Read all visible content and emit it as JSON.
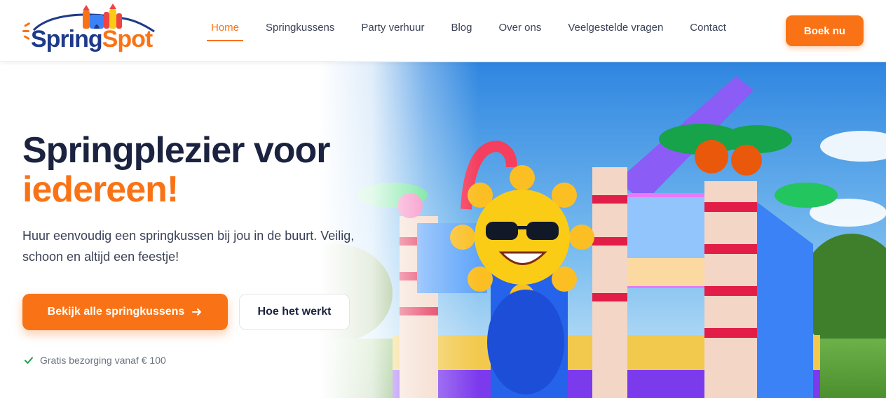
{
  "brand": {
    "name_part1": "Spring",
    "name_part2": "Spot"
  },
  "nav": {
    "items": [
      {
        "label": "Home",
        "active": true
      },
      {
        "label": "Springkussens"
      },
      {
        "label": "Party verhuur"
      },
      {
        "label": "Blog"
      },
      {
        "label": "Over ons"
      },
      {
        "label": "Veelgestelde vragen"
      },
      {
        "label": "Contact"
      }
    ],
    "cta_label": "Boek nu"
  },
  "hero": {
    "title_line1": "Springplezier voor",
    "title_line2": "iedereen!",
    "subtitle": "Huur eenvoudig een springkussen bij jou in de buurt. Veilig, schoon en altijd een feestje!",
    "primary_button": "Bekijk alle springkussens",
    "secondary_button": "Hoe het werkt",
    "perk": "Gratis bezorging vanaf € 100"
  },
  "colors": {
    "accent": "#f97316",
    "navy": "#1b2340",
    "brand_blue": "#1e3a8a",
    "check": "#16a34a"
  },
  "icons": {
    "primary_button_icon": "arrow-right-icon",
    "perk_icon": "check-icon"
  }
}
